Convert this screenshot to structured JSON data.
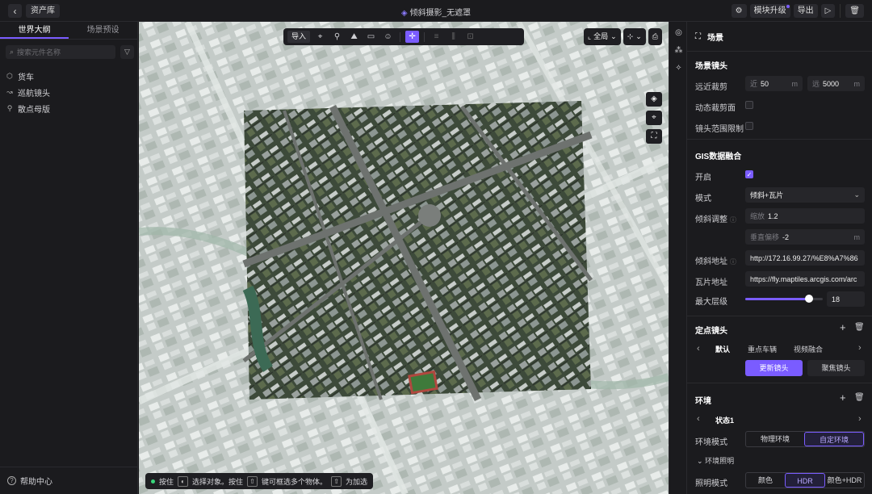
{
  "topbar": {
    "back_icon": "chevron-left-icon",
    "asset_label": "资产库",
    "title": "倾斜摄影_无遮罩",
    "title_icon": "cube-icon",
    "settings_icon": "gear-icon",
    "upgrade_label": "模块升级",
    "export_label": "导出",
    "play_icon": "play-icon",
    "trash_icon": "trash-icon"
  },
  "left": {
    "tabs": [
      {
        "label": "世界大纲"
      },
      {
        "label": "场景预设"
      }
    ],
    "search_placeholder": "搜索元件名称",
    "filter_icon": "filter-icon",
    "tree": [
      {
        "label": "货车",
        "icon": "cube-icon"
      },
      {
        "label": "巡航镜头",
        "icon": "camera-path-icon"
      },
      {
        "label": "散点母版",
        "icon": "pin-group-icon"
      }
    ],
    "help_label": "帮助中心"
  },
  "viewport": {
    "import_label": "导入",
    "view_label": "全局",
    "hint": {
      "part1": "按住",
      "part2": "选择对象。按住",
      "part3": "键可框选多个物体。",
      "part4": "为加选"
    }
  },
  "right": {
    "header_title": "场景",
    "camera": {
      "title": "场景镜头",
      "clip_label": "远近裁剪",
      "near_prefix": "近",
      "near_value": "50",
      "far_prefix": "远",
      "far_value": "5000",
      "unit": "m",
      "dynamic_clip_label": "动态裁剪面",
      "range_limit_label": "镜头范围限制"
    },
    "gis": {
      "title": "GIS数据融合",
      "enable_label": "开启",
      "enabled": true,
      "mode_label": "模式",
      "mode_value": "倾斜+瓦片",
      "tilt_adjust_label": "倾斜调整",
      "scale_prefix": "缩放",
      "scale_value": "1.2",
      "offset_prefix": "垂直偏移",
      "offset_value": "-2",
      "offset_unit": "m",
      "tilt_url_label": "倾斜地址",
      "tilt_url": "http://172.16.99.27/%E8%A7%86",
      "tile_url_label": "瓦片地址",
      "tile_url": "https://fly.maptiles.arcgis.com/arc",
      "max_level_label": "最大层级",
      "max_level": 18,
      "max_level_fraction": 0.82
    },
    "fixed_camera": {
      "title": "定点镜头",
      "tabs": [
        "默认",
        "重点车辆",
        "视频融合"
      ],
      "update_label": "更新镜头",
      "focus_label": "聚焦镜头"
    },
    "environment": {
      "title": "环境",
      "state_label": "状态1",
      "env_mode_label": "环境模式",
      "env_modes": [
        "物理环境",
        "自定环境"
      ],
      "env_mode_active": "自定环境",
      "lighting_label": "环境照明",
      "light_mode_label": "照明模式",
      "light_modes": [
        "颜色",
        "HDR",
        "颜色+HDR"
      ],
      "light_mode_active": "HDR"
    }
  },
  "colors": {
    "accent": "#7a5cff",
    "panel": "#1b1b1e",
    "field": "#26262a"
  }
}
